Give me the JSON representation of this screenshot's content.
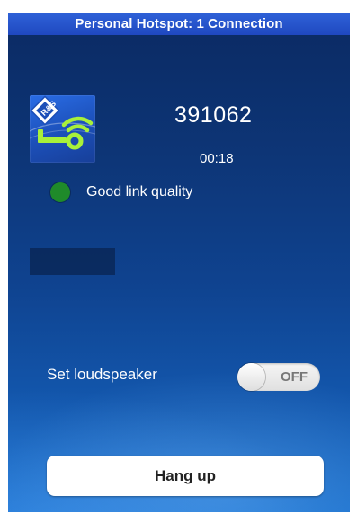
{
  "status_bar": {
    "text": "Personal Hotspot: 1 Connection",
    "color": "#2f62d8"
  },
  "call": {
    "number": "391062",
    "duration": "00:18"
  },
  "link_quality": {
    "text": "Good link quality",
    "indicator_color": "#1f8a2a"
  },
  "loudspeaker": {
    "label": "Set loudspeaker",
    "state_label": "OFF",
    "on": false
  },
  "actions": {
    "hang_up_label": "Hang up"
  },
  "icons": {
    "logo": "rohde-schwarz-key-signal-icon"
  },
  "colors": {
    "background": "#0d3576",
    "accent_green": "#a8f03a",
    "quality_green": "#1f8a2a"
  }
}
